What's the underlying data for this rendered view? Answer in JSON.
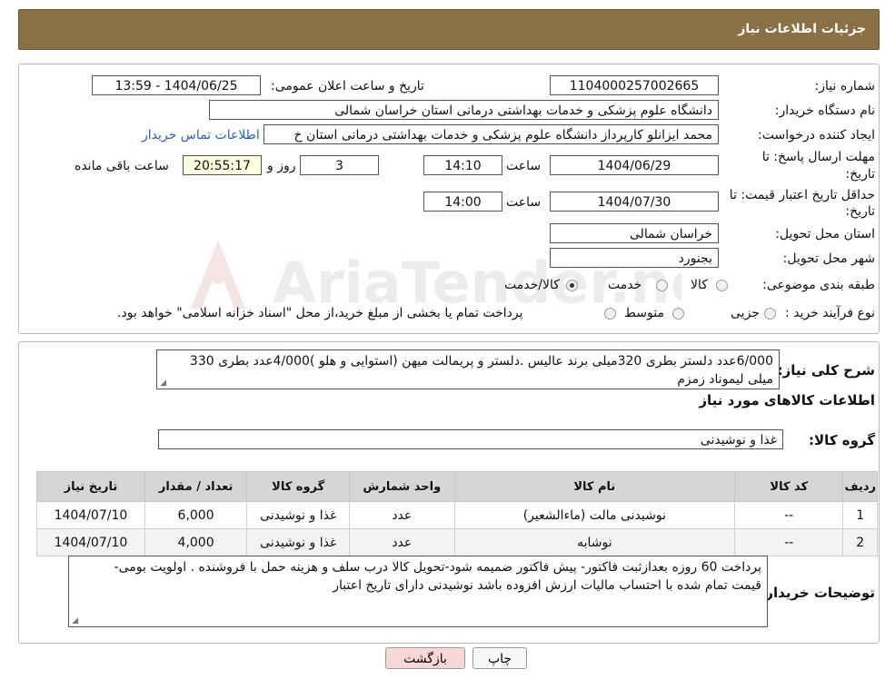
{
  "header": {
    "title": "جزئیات اطلاعات نیاز"
  },
  "watermark": {
    "text": "AriaTender.neT"
  },
  "form": {
    "need_number_label": "شماره نیاز:",
    "need_number": "1104000257002665",
    "announce_label": "تاریخ و ساعت اعلان عمومی:",
    "announce_value": "1404/06/25 - 13:59",
    "buyer_org_label": "نام دستگاه خریدار:",
    "buyer_org": "دانشگاه علوم پزشکی و خدمات بهداشتی درمانی استان خراسان شمالی",
    "creator_label": "ایجاد کننده درخواست:",
    "creator": "محمد ایزانلو کارپرداز دانشگاه علوم پزشکی و خدمات بهداشتی درمانی استان خ",
    "contact_link": "اطلاعات تماس خریدار",
    "deadline_label_1": "مهلت ارسال پاسخ: تا",
    "deadline_label_2": "تاریخ:",
    "deadline_date": "1404/06/29",
    "time_label": "ساعت",
    "deadline_time": "14:10",
    "days_value": "3",
    "days_label": "روز و",
    "remaining_value": "20:55:17",
    "remaining_label": "ساعت باقی مانده",
    "validity_label_1": "حداقل تاریخ اعتبار قیمت: تا",
    "validity_label_2": "تاریخ:",
    "validity_date": "1404/07/30",
    "validity_time": "14:00",
    "province_label": "استان محل تحویل:",
    "province": "خراسان شمالی",
    "city_label": "شهر محل تحویل:",
    "city": "بجنورد",
    "category_label": "طبقه بندی موضوعی:",
    "category_options": [
      "کالا",
      "خدمت",
      "کالا/خدمت"
    ],
    "process_label": "نوع فرآیند خرید :",
    "process_options": [
      "جزیی",
      "متوسط"
    ],
    "process_note": "پرداخت تمام یا بخشی از مبلغ خرید،از محل \"اسناد خزانه اسلامی\" خواهد بود."
  },
  "summary": {
    "label": "شرح کلی نیاز:",
    "line1": "6/000عدد دلستر بطری 320میلی برند عالیس .دلستر و پریمالت میهن (استوایی و هلو )4/000عدد بطری 330",
    "line2": "میلی لیموناد زمزم",
    "items_title": "اطلاعات کالاهای مورد نیاز",
    "group_label": "گروه کالا:",
    "group_value": "غذا و نوشیدنی"
  },
  "table": {
    "headers": [
      "ردیف",
      "کد کالا",
      "نام کالا",
      "واحد شمارش",
      "گروه کالا",
      "تعداد / مقدار",
      "تاریخ نیاز"
    ],
    "rows": [
      [
        "1",
        "--",
        "نوشیدنی مالت (ماءالشعیر)",
        "عدد",
        "غذا و نوشیدنی",
        "6,000",
        "1404/07/10"
      ],
      [
        "2",
        "--",
        "نوشابه",
        "عدد",
        "غذا و نوشیدنی",
        "4,000",
        "1404/07/10"
      ]
    ]
  },
  "buyer_notes": {
    "label": "توضیحات خریدار:",
    "line1": "پرداخت 60 روزه بعدازثبت فاکتور- پیش فاکتور ضمیمه شود-تحویل کالا درب سلف و هزینه حمل با فروشنده . اولویت بومی-",
    "line2": "قیمت  تمام شده با احتساب مالیات ارزش افزوده باشد  نوشیدنی دارای تاریخ اعتبار"
  },
  "buttons": {
    "print": "چاپ",
    "back": "بازگشت"
  },
  "colors": {
    "header_bg": "#8b7046",
    "back_button_bg": "#f8d7d7",
    "yellow_box": "#ffffe0"
  }
}
